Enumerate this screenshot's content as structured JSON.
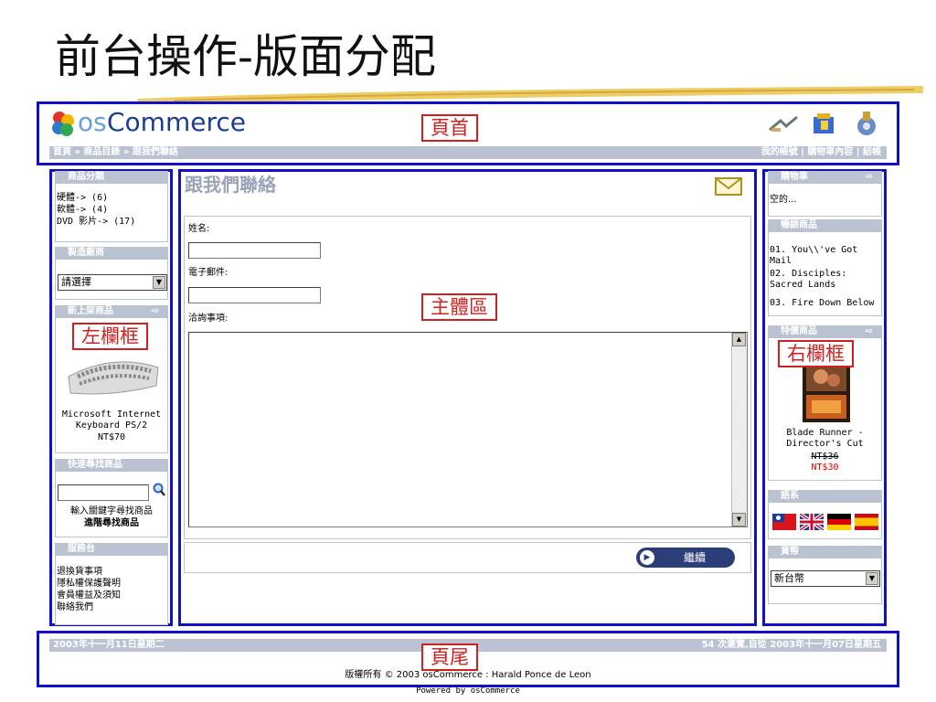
{
  "slide": {
    "title": "前台操作-版面分配"
  },
  "labels": {
    "header": "頁首",
    "main": "主體區",
    "left": "左欄框",
    "right": "右欄框",
    "footer": "頁尾"
  },
  "header": {
    "logo_os": "os",
    "logo_commerce": "Commerce",
    "breadcrumb": "首頁 » 商品目錄 » 跟我們聯絡",
    "nav": [
      "我的帳號",
      "購物車內容",
      "結帳"
    ]
  },
  "left": {
    "categories": {
      "title": "商品分類",
      "items": [
        "硬體-> (6)",
        "軟體-> (4)",
        "DVD 影片-> (17)"
      ]
    },
    "manufacturers": {
      "title": "製造廠商",
      "select_value": "請選擇"
    },
    "whats_new": {
      "title": "新上架商品",
      "product_name": "Microsoft Internet Keyboard PS/2",
      "product_price": "NT$70"
    },
    "quick_find": {
      "title": "快速尋找商品",
      "hint": "輸入關鍵字尋找商品",
      "advanced": "進階尋找商品"
    },
    "information": {
      "title": "服務台",
      "links": [
        "退換貨事項",
        "隱私權保護聲明",
        "會員權益及須知",
        "聯絡我們"
      ]
    }
  },
  "main": {
    "heading": "跟我們聯絡",
    "name_label": "姓名:",
    "email_label": "電子郵件:",
    "enquiry_label": "洽詢事項:",
    "continue_label": "繼續"
  },
  "right": {
    "cart": {
      "title": "購物車",
      "content": "空的..."
    },
    "bestsellers": {
      "title": "暢銷商品",
      "items": [
        "01. You\\\\'ve Got Mail",
        "02. Disciples: Sacred Lands",
        "03. Fire Down Below"
      ]
    },
    "specials": {
      "title": "特價商品",
      "product_name": "Blade Runner - Director's Cut",
      "old_price": "NT$36",
      "new_price": "NT$30"
    },
    "languages": {
      "title": "語系"
    },
    "currencies": {
      "title": "貨幣",
      "select_value": "新台幣"
    }
  },
  "footer": {
    "date": "2003年十一月11日星期二",
    "counter": "54 次瀏覽,自從 2003年十一月07日星期五",
    "copyright": "版權所有 © 2003 osCommerce : Harald Ponce de Leon",
    "powered": "Powered by osCommerce"
  },
  "colors": {
    "frame": "#1010c8",
    "label_red": "#d02020",
    "bar": "#bbc3d3",
    "price_red": "#e00000"
  }
}
